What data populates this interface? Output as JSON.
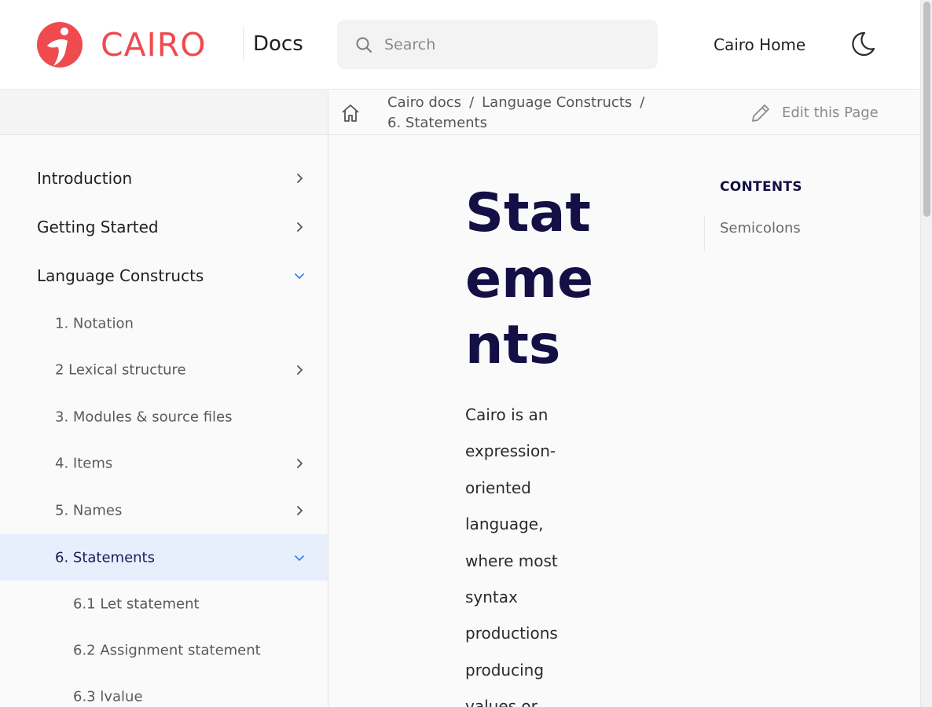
{
  "header": {
    "logo_text": "CAIRO",
    "docs_label": "Docs",
    "search_placeholder": "Search",
    "home_link": "Cairo Home",
    "theme_toggle_icon": "moon-icon",
    "brand_color": "#ef4b4f"
  },
  "breadcrumb": {
    "items": [
      "Cairo docs",
      "Language Constructs",
      "6. Statements"
    ],
    "separator": "/",
    "home_icon": "home-icon"
  },
  "edit_page": {
    "label": "Edit this Page",
    "icon": "pencil-icon"
  },
  "sidebar": {
    "items": [
      {
        "label": "Introduction",
        "icon": "chevron-right-icon"
      },
      {
        "label": "Getting Started",
        "icon": "chevron-right-icon"
      },
      {
        "label": "Language Constructs",
        "icon": "chevron-down-icon"
      },
      {
        "label": "1. Notation"
      },
      {
        "label": "2 Lexical structure",
        "icon": "chevron-right-icon"
      },
      {
        "label": "3. Modules & source files"
      },
      {
        "label": "4. Items",
        "icon": "chevron-right-icon"
      },
      {
        "label": "5. Names",
        "icon": "chevron-right-icon"
      },
      {
        "label": "6. Statements",
        "icon": "chevron-down-icon",
        "active": true
      },
      {
        "label": "6.1 Let statement"
      },
      {
        "label": "6.2 Assignment statement"
      },
      {
        "label": "6.3 lvalue"
      }
    ],
    "active_bg": "#e8effc"
  },
  "main": {
    "title": "Statements",
    "body": "Cairo is an expression-oriented language, where most syntax productions producing values or"
  },
  "toc": {
    "heading": "CONTENTS",
    "items": [
      "Semicolons"
    ]
  },
  "colors": {
    "title": "#141045",
    "accent_chevron": "#3b82f6"
  }
}
